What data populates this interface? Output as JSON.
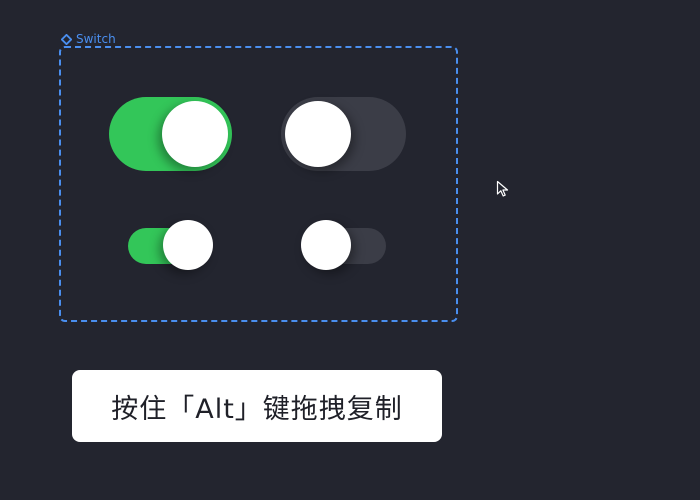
{
  "component": {
    "label": "Switch",
    "icon": "component-diamond-icon",
    "accent_color": "#4a8ff0"
  },
  "switches": [
    {
      "size": "large",
      "state": "on",
      "color": "#33c659"
    },
    {
      "size": "large",
      "state": "off",
      "color": "#3b3d47"
    },
    {
      "size": "small",
      "state": "on",
      "color": "#33c659"
    },
    {
      "size": "small",
      "state": "off",
      "color": "#3b3d47"
    }
  ],
  "hint": {
    "text": "按住「Alt」键拖拽复制"
  },
  "cursor": {
    "icon": "arrow-cursor-icon"
  },
  "colors": {
    "background": "#23252f",
    "switch_on": "#33c659",
    "switch_off": "#3b3d47",
    "knob": "#ffffff"
  }
}
